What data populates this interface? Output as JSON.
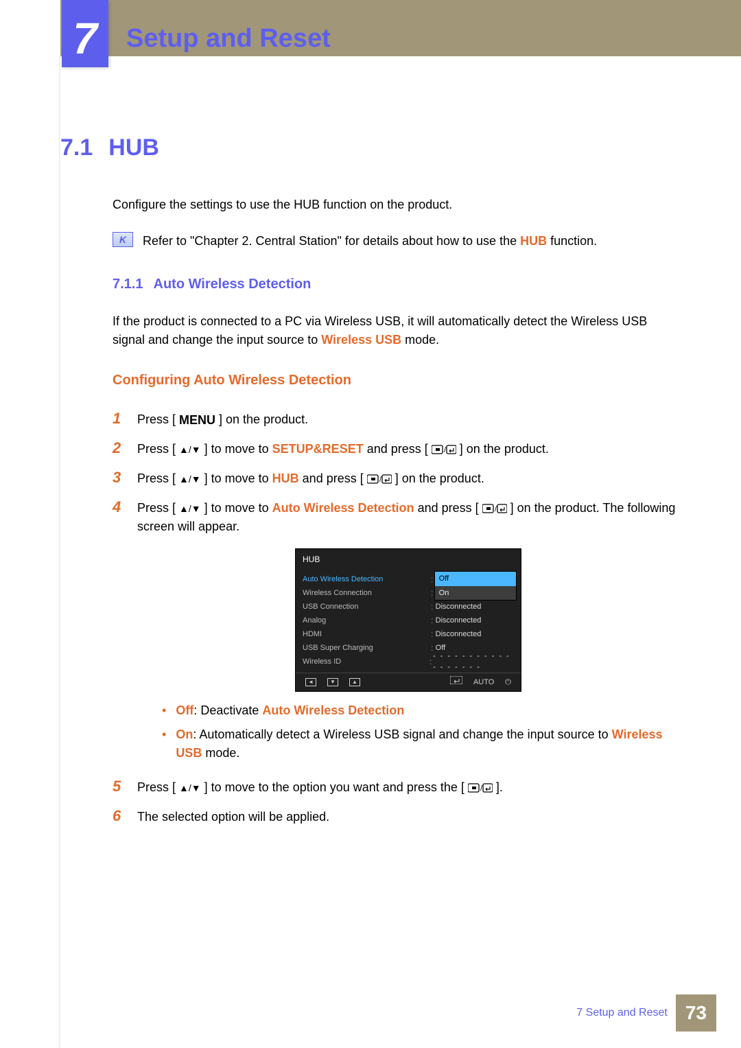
{
  "chapter": {
    "number": "7",
    "title": "Setup and Reset"
  },
  "section": {
    "number": "7.1",
    "title": "HUB",
    "intro": "Configure the settings to use the HUB function on the product.",
    "note_pre": "Refer to \"Chapter 2. Central Station\" for details about how to use the ",
    "note_hl": "HUB",
    "note_post": " function."
  },
  "subsection": {
    "number": "7.1.1",
    "title": "Auto Wireless Detection",
    "para_pre": "If the product is connected to a PC via Wireless USB, it will automatically detect the Wireless USB signal and change the input source to ",
    "para_hl": "Wireless USB",
    "para_post": " mode."
  },
  "config_heading": "Configuring Auto Wireless Detection",
  "steps": {
    "s1": {
      "num": "1",
      "pre": "Press [ ",
      "menu": "MENU",
      "post": " ] on the product."
    },
    "s2": {
      "num": "2",
      "pre": "Press [ ",
      "mid1": " ] to move to ",
      "hl": "SETUP&RESET",
      "mid2": " and press [ ",
      "post": " ] on the product."
    },
    "s3": {
      "num": "3",
      "pre": "Press [ ",
      "mid1": " ] to move to ",
      "hl": "HUB",
      "mid2": " and press [ ",
      "post": " ] on the product."
    },
    "s4": {
      "num": "4",
      "pre": "Press [ ",
      "mid1": " ] to move to ",
      "hl": "Auto Wireless Detection",
      "mid2": " and press [ ",
      "post": " ] on the product. The following screen will appear."
    },
    "s5": {
      "num": "5",
      "pre": "Press [ ",
      "mid1": " ] to move to the option you want and press the [ ",
      "post": " ]."
    },
    "s6": {
      "num": "6",
      "text": "The selected option will be applied."
    }
  },
  "bullets": {
    "b1": {
      "label": "Off",
      "sep": ": Deactivate ",
      "hl": "Auto Wireless Detection"
    },
    "b2": {
      "label": "On",
      "sep": ": Automatically detect a Wireless USB signal and change the input source to ",
      "hl": "Wireless USB",
      "post": " mode."
    }
  },
  "osd": {
    "title": "HUB",
    "rows": [
      {
        "label": "Auto Wireless Detection",
        "value": ""
      },
      {
        "label": "Wireless Connection",
        "value": ""
      },
      {
        "label": "USB Connection",
        "value": "Disconnected"
      },
      {
        "label": "Analog",
        "value": "Disconnected"
      },
      {
        "label": "HDMI",
        "value": "Disconnected"
      },
      {
        "label": "USB Super Charging",
        "value": "Off"
      },
      {
        "label": "Wireless ID",
        "value": "- - - - - - - - - - - - - - - - - -"
      }
    ],
    "dropdown": {
      "off": "Off",
      "on": "On"
    },
    "footer": {
      "auto": "AUTO"
    }
  },
  "footer": {
    "chapter": "7 Setup and Reset",
    "page": "73"
  }
}
